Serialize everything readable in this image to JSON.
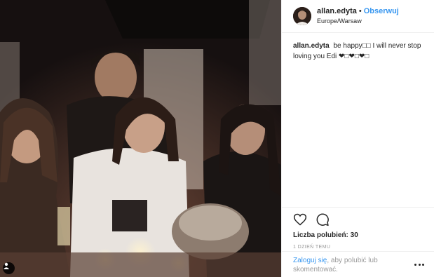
{
  "post": {
    "username": "allan.edyta",
    "separator": "•",
    "follow_label": "Obserwuj",
    "location": "Europe/Warsaw",
    "caption_text": "be happy□□ I will never stop loving you Edi ❤□❤□❤□",
    "likes_label": "Liczba polubień: 30",
    "time_label": "1 DZIEŃ TEMU",
    "login_link": "Zaloguj się",
    "login_text": ", aby polubić lub skomentować."
  },
  "icons": {
    "like": "heart-icon",
    "comment": "speech-bubble-icon",
    "more": "more-options-icon",
    "tag": "user-tag-icon"
  },
  "colors": {
    "accent": "#3897f0",
    "text": "#262626",
    "muted": "#999999",
    "border": "#efefef"
  }
}
